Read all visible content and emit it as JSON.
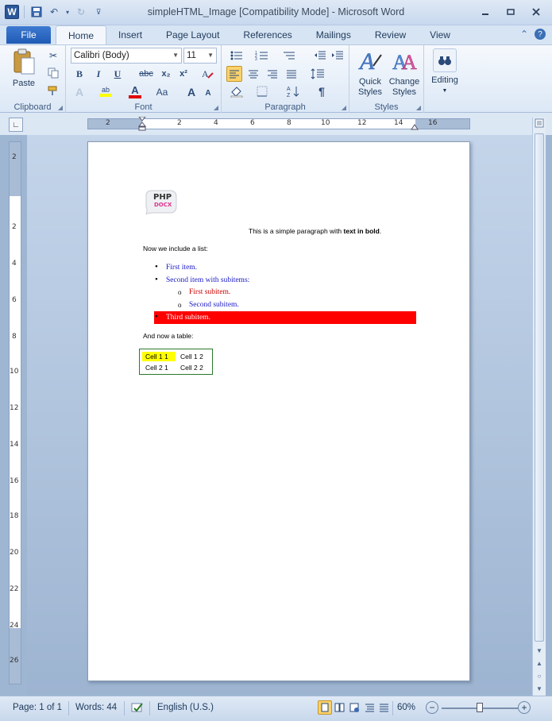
{
  "window": {
    "title": "simpleHTML_Image [Compatibility Mode]  -  Microsoft Word",
    "app_icon": "W"
  },
  "tabs": {
    "file": "File",
    "items": [
      "Home",
      "Insert",
      "Page Layout",
      "References",
      "Mailings",
      "Review",
      "View"
    ],
    "active": "Home"
  },
  "ribbon": {
    "clipboard": {
      "paste": "Paste",
      "label": "Clipboard"
    },
    "font": {
      "family": "Calibri (Body)",
      "size": "11",
      "label": "Font",
      "bold": "B",
      "italic": "I",
      "underline": "U",
      "strike": "abc",
      "sub": "x₂",
      "sup": "x²",
      "grow": "A",
      "shrink": "A",
      "case": "Aa",
      "highlight_label": "ab"
    },
    "paragraph": {
      "label": "Paragraph",
      "pilcrow": "¶"
    },
    "styles": {
      "quick": "Quick Styles",
      "change": "Change Styles",
      "label": "Styles"
    },
    "editing": {
      "label": "Editing"
    }
  },
  "ruler": {
    "h_numbers": [
      "2",
      "2",
      "4",
      "6",
      "8",
      "10",
      "12",
      "14",
      "16"
    ],
    "v_numbers": [
      "2",
      "2",
      "4",
      "6",
      "8",
      "10",
      "12",
      "14",
      "16",
      "18",
      "20",
      "22",
      "24",
      "26"
    ]
  },
  "document": {
    "intro_plain": "This is a simple paragraph with ",
    "intro_bold": "text in bold",
    "intro_end": ".",
    "list_intro": "Now we include a list:",
    "item1": "First item.",
    "item2": "Second item with subitems:",
    "sub1": "First subitem.",
    "sub2": "Second subitem.",
    "item3": "Third subitem.",
    "table_intro": "And now a table:",
    "table": [
      [
        "Cell 1 1",
        "Cell 1 2"
      ],
      [
        "Cell 2 1",
        "Cell 2 2"
      ]
    ],
    "logo_line1": "PHP",
    "logo_line2": "DOCX"
  },
  "status": {
    "page": "Page: 1 of 1",
    "words": "Words: 44",
    "language": "English (U.S.)",
    "zoom": "60%",
    "zoom_fraction": 0.5
  },
  "colors": {
    "highlight_yellow": "#ffff00",
    "item3_bg": "#ff0000",
    "blue_text": "#1a1ac4",
    "red_text": "#cc0000",
    "table_border": "#2a7a2a"
  }
}
